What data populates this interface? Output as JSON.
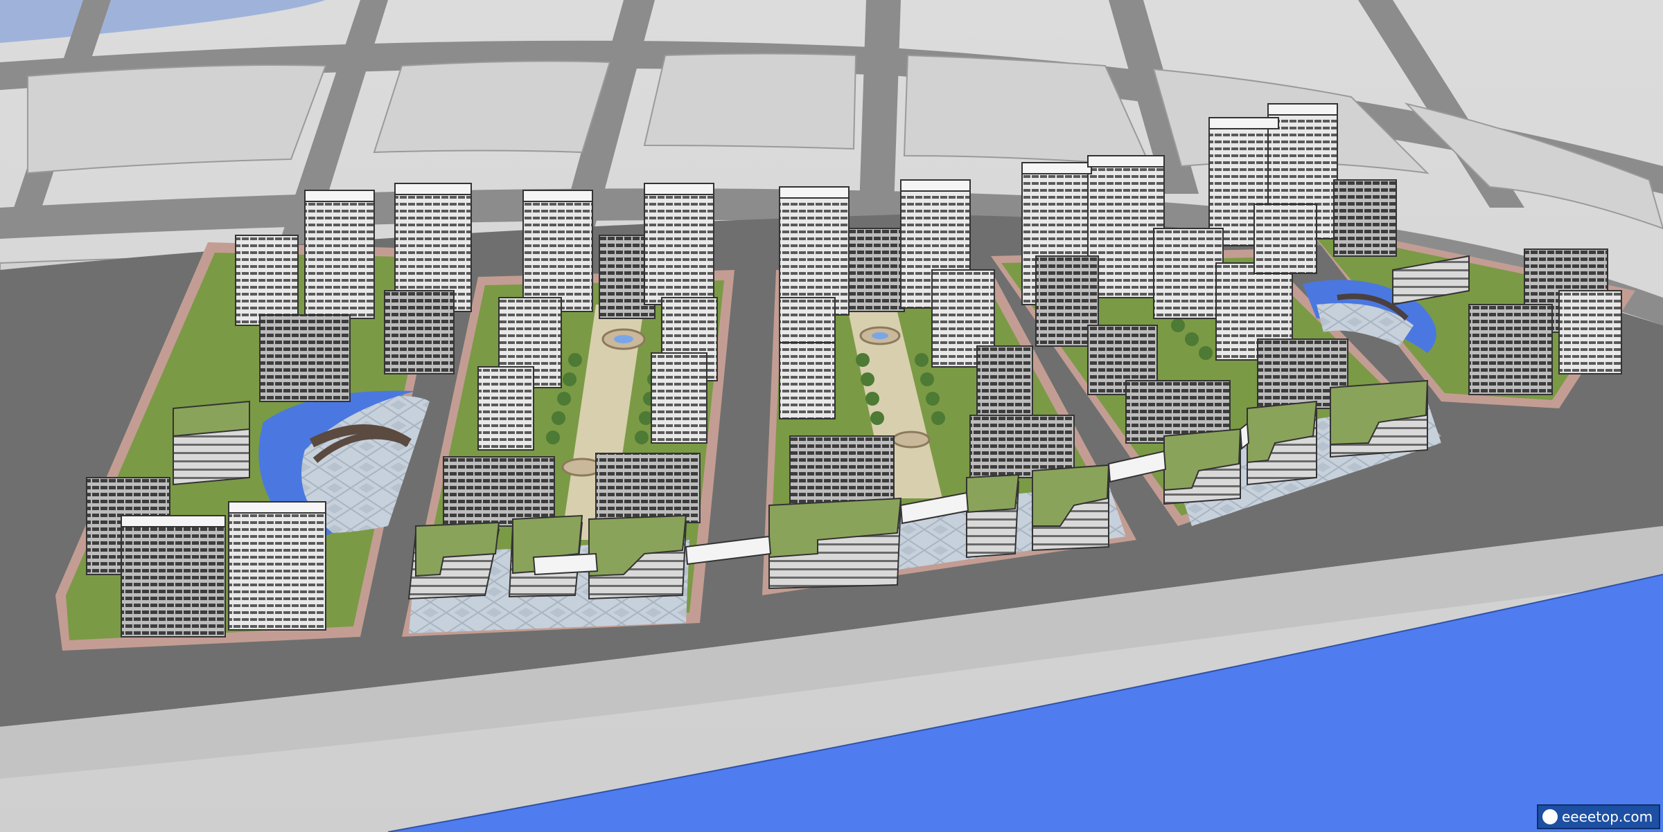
{
  "scene": {
    "subject": "residential-masterplan-aerial-render",
    "colors": {
      "ground": "#d4d4d4",
      "road": "#8c8c8c",
      "plot_border": "#c39d93",
      "lawn": "#7b9a45",
      "paving": "#c7d1dc",
      "water": "#4f7df0",
      "pond": "#4a78e0",
      "tower_light": "#ededed",
      "tower_dark": "#4a4a4a",
      "roof_green": "#8aa35a",
      "bridge": "#f4f4f4",
      "tree": "#4d7a34"
    }
  },
  "watermark": {
    "icon": "e-tuo-logo-icon",
    "text": "eeeetop.com"
  }
}
